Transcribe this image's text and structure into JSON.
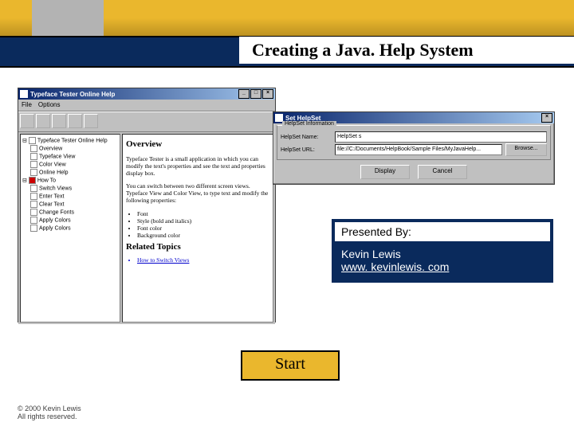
{
  "title": "Creating a Java. Help System",
  "help_window": {
    "title": "Typeface Tester Online Help",
    "menu": {
      "file": "File",
      "options": "Options"
    },
    "toc": [
      "Typeface Tester Online Help",
      "Overview",
      "Typeface View",
      "Color View",
      "Online Help",
      "How To",
      "Switch Views",
      "Enter Text",
      "Clear Text",
      "Change Fonts",
      "Apply Colors",
      "Apply Colors"
    ],
    "content": {
      "heading": "Overview",
      "p1": "Typeface Tester is a small application in which you can modify the text's properties and see the text and properties display box.",
      "p2": "You can switch between two different screen views. Typeface View and Color View, to type text and modify the following properties:",
      "bullets": [
        "Font",
        "Style (bold and italics)",
        "Font color",
        "Background color"
      ],
      "related_heading": "Related Topics",
      "related_item": "How to Switch Views"
    }
  },
  "dialog": {
    "title": "Set HelpSet",
    "group": "HelpSet Information",
    "name_label": "HelpSet Name:",
    "name_value": "HelpSet s",
    "url_label": "HelpSet URL:",
    "url_value": "file://C:/Documents/HelpBook/Sample Files/MyJavaHelp...",
    "browse": "Browse...",
    "display": "Display",
    "cancel": "Cancel"
  },
  "presented": {
    "header": "Presented By:",
    "name": "Kevin Lewis",
    "url": "www. kevinlewis. com"
  },
  "start": "Start",
  "footer": {
    "copyright": "© 2000 Kevin Lewis",
    "rights": "All rights reserved."
  }
}
